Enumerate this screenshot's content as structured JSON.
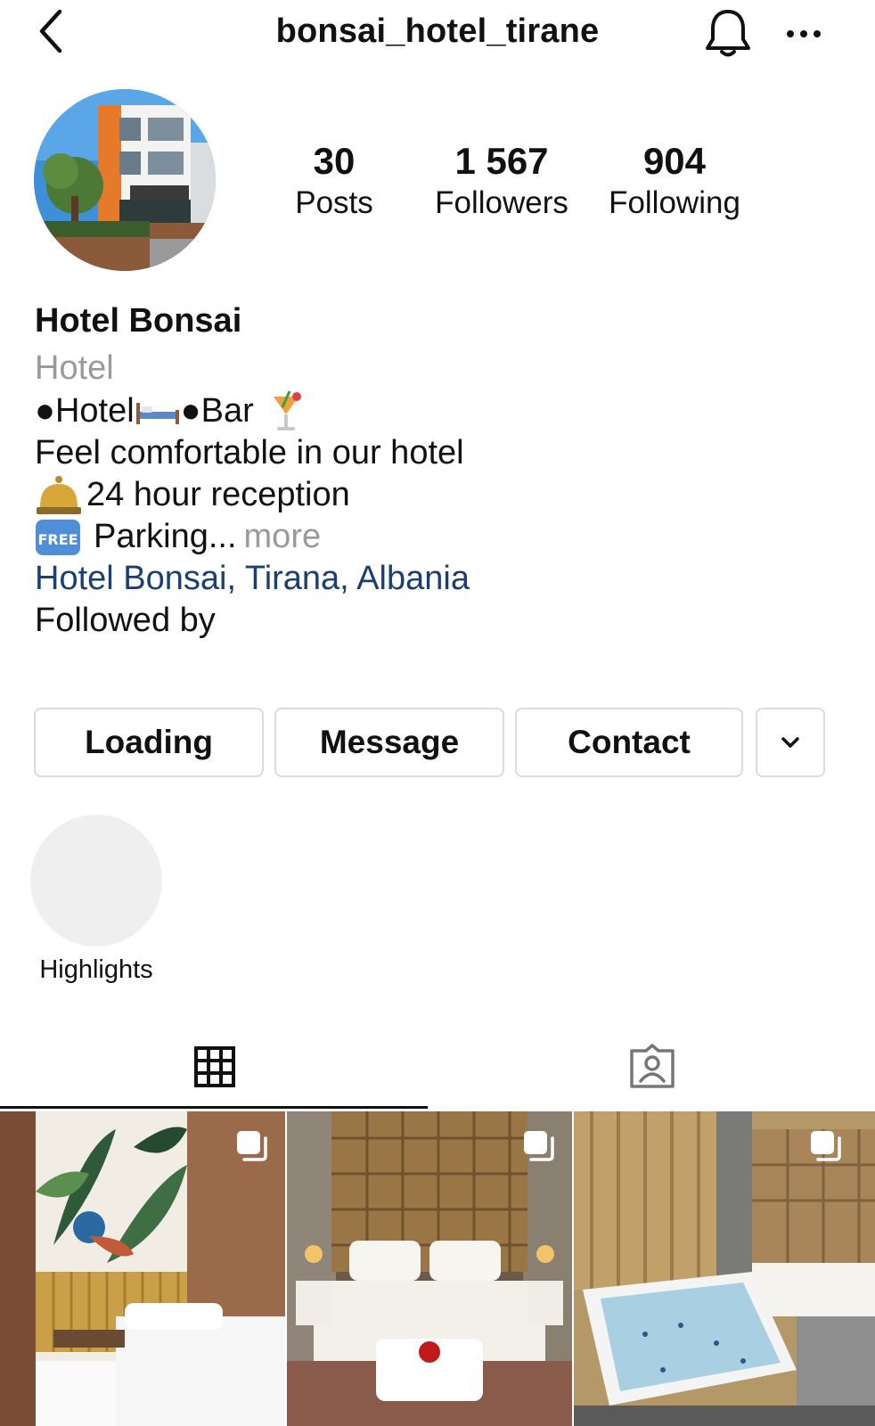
{
  "header": {
    "username": "bonsai_hotel_tirane",
    "back_icon": "chevron-left-icon",
    "bell_icon": "bell-icon",
    "more_icon": "more-horizontal-icon"
  },
  "profile": {
    "stats": [
      {
        "value": "30",
        "label": "Posts"
      },
      {
        "value": "1 567",
        "label": "Followers"
      },
      {
        "value": "904",
        "label": "Following"
      }
    ],
    "name": "Hotel Bonsai",
    "category": "Hotel",
    "bio": {
      "line1_a": "●Hotel",
      "line1_b": " ●Bar",
      "line2": "Feel comfortable in our hotel",
      "line3": "24 hour reception",
      "line4": "Parking...",
      "more": "more"
    },
    "location": "Hotel Bonsai, Tirana, Albania",
    "followed_by": "Followed by"
  },
  "actions": {
    "loading": "Loading",
    "message": "Message",
    "contact": "Contact"
  },
  "highlights": {
    "label": "Highlights"
  },
  "tabs": {
    "grid_icon": "grid-icon",
    "tagged_icon": "tagged-person-icon"
  },
  "posts": [
    {
      "alt": "Hotel room with botanical peacock mural and twin beds",
      "multi": true
    },
    {
      "alt": "Double bed with padded headboard and rose petals",
      "multi": true
    },
    {
      "alt": "Room with jacuzzi bathtub and gold curtains",
      "multi": true
    }
  ],
  "colors": {
    "link": "#1b3f74",
    "muted": "#9a9a9a",
    "border": "#dbdbdb",
    "highlight_bg": "#efefef"
  }
}
